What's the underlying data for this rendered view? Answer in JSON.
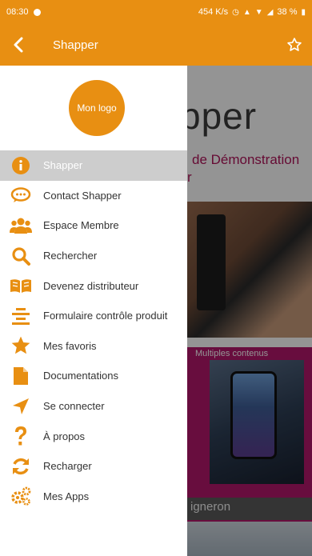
{
  "status_bar": {
    "time": "08:30",
    "network_speed": "454 K/s",
    "battery": "38 %"
  },
  "app_bar": {
    "title": "Shapper"
  },
  "drawer": {
    "logo_text": "Mon logo",
    "items": [
      {
        "label": "Shapper",
        "icon": "info-icon",
        "active": true
      },
      {
        "label": "Contact Shapper",
        "icon": "chat-bubble-icon",
        "active": false
      },
      {
        "label": "Espace Membre",
        "icon": "users-icon",
        "active": false
      },
      {
        "label": "Rechercher",
        "icon": "search-icon",
        "active": false
      },
      {
        "label": "Devenez distributeur",
        "icon": "open-book-icon",
        "active": false
      },
      {
        "label": "Formulaire contrôle produit",
        "icon": "align-center-icon",
        "active": false
      },
      {
        "label": "Mes favoris",
        "icon": "star-icon",
        "active": false
      },
      {
        "label": "Documentations",
        "icon": "document-icon",
        "active": false
      },
      {
        "label": "Se connecter",
        "icon": "location-arrow-icon",
        "active": false
      },
      {
        "label": "À propos",
        "icon": "question-mark-icon",
        "active": false
      },
      {
        "label": "Recharger",
        "icon": "refresh-icon",
        "active": false
      },
      {
        "label": "Mes Apps",
        "icon": "gears-icon",
        "active": false
      }
    ]
  },
  "background": {
    "brand_partial": "pper",
    "subtitle": "de Démonstration",
    "subtitle_partial": "r",
    "card_label": "Multiples contenus",
    "band_label": "igneron"
  },
  "colors": {
    "accent": "#e88f12",
    "active_item_bg": "#cdcdcd",
    "magenta": "#b3186b"
  }
}
